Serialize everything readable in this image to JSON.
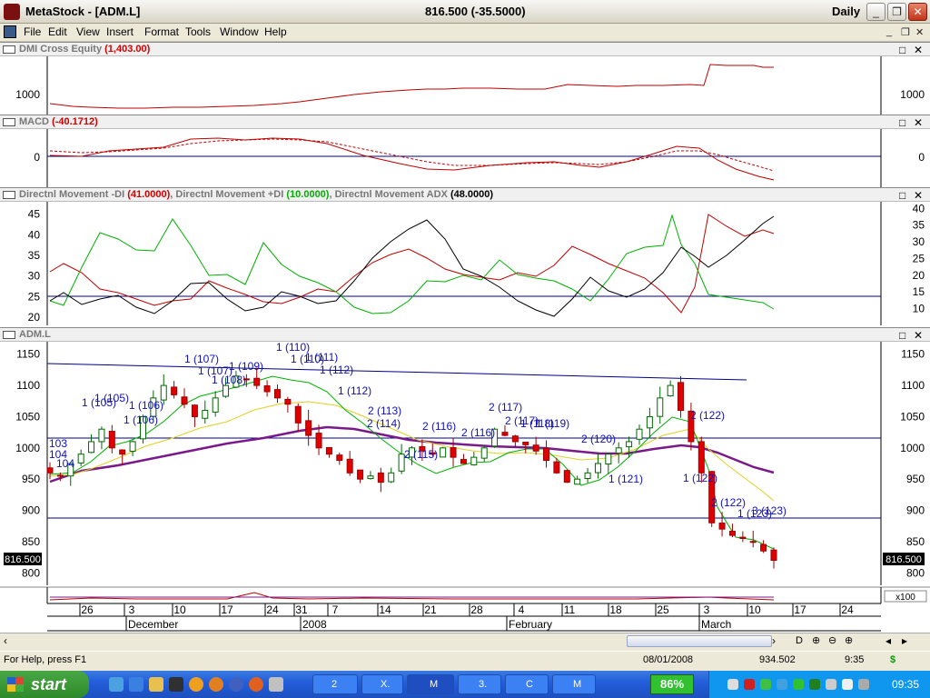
{
  "window": {
    "title": "MetaStock - [ADM.L]",
    "center_text": "816.500 (-35.5000)",
    "period": "Daily",
    "controls": [
      "_",
      "❐",
      "✕"
    ]
  },
  "menu": [
    "File",
    "Edit",
    "View",
    "Insert",
    "Format",
    "Tools",
    "Window",
    "Help"
  ],
  "mdi_controls": [
    "_",
    "❐",
    "✕"
  ],
  "panes": {
    "equity": {
      "name": "DMI Cross Equity",
      "value": "(1,403.00)",
      "y_tick": "1000"
    },
    "macd": {
      "name": "MACD",
      "value": "(-40.1712)",
      "y_tick": "0"
    },
    "dmi": {
      "minus_name": "Directnl Movement -DI",
      "minus_value": "(41.0000)",
      "plus_name": "Directnl Movement +DI",
      "plus_value": "(10.0000)",
      "adx_name": "Directnl Movement ADX",
      "adx_value": "(48.0000)",
      "left_ticks": [
        "45",
        "40",
        "35",
        "30",
        "25",
        "20"
      ],
      "right_ticks": [
        "40",
        "35",
        "30",
        "25",
        "20",
        "15",
        "10"
      ]
    },
    "price": {
      "name": "ADM.L",
      "ticks": [
        "1150",
        "1100",
        "1050",
        "1000",
        "950",
        "900",
        "850",
        "800"
      ],
      "last_price_label": "816.500",
      "signals": [
        "1 (107)",
        "1 (107)",
        "1 (108)",
        "1 (109)",
        "1 (110)",
        "1 (110)",
        "1 (111)",
        "1 (112)",
        "1 (112)",
        "1 (105)",
        "1 (105)",
        "1 (106)",
        "1 (106)",
        "103",
        "104",
        "104",
        "2 (113)",
        "2 (114)",
        "2 (115)",
        "2 (116)",
        "2 (116)",
        "2 (117)",
        "2 (117)",
        "1 (118)",
        "1 (119)",
        "2 (120)",
        "1 (121)",
        "2 (122)",
        "1 (122)",
        "2 (122)",
        "1 (123)",
        "3 (123)"
      ]
    },
    "volume_label": "x100"
  },
  "chart_data": {
    "type": "line",
    "x_ticks": [
      "26",
      "3",
      "10",
      "17",
      "24",
      "31",
      "7",
      "14",
      "21",
      "28",
      "4",
      "11",
      "18",
      "25",
      "3",
      "10",
      "17",
      "24"
    ],
    "x_periods": [
      "December",
      "2008",
      "February",
      "March"
    ],
    "price_ylim": [
      780,
      1170
    ],
    "dmi_ylim": [
      18,
      48
    ],
    "adx_ylim": [
      5,
      42
    ]
  },
  "scrollbar": {
    "buttons": [
      "‹",
      "›",
      "D",
      "⊕",
      "⊖",
      "⊕",
      "◂",
      "▸"
    ]
  },
  "status": {
    "help": "For Help, press F1",
    "date": "08/01/2008",
    "value": "934.502",
    "time": "9:35",
    "currency": "$"
  },
  "taskbar": {
    "start": "start",
    "buttons": [
      "2",
      "X.",
      "M",
      "3.",
      "C",
      "M"
    ],
    "zoom": "86%",
    "clock": "09:35"
  }
}
